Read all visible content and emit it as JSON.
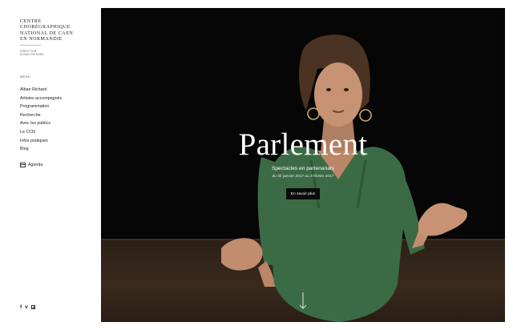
{
  "sidebar": {
    "logo_lines": [
      "CENTRE",
      "CHORÉGRAPHIQUE",
      "NATIONAL DE CAEN",
      "EN NORMANDIE"
    ],
    "direction_lines": [
      "DIRECTION",
      "ALBAN RICHARD"
    ],
    "menu_label": "MENU",
    "nav_items": [
      "Alban Richard",
      "Artistes accompagnés",
      "Programmation",
      "Recherche",
      "Avec les publics",
      "Le CCN",
      "Infos pratiques",
      "Blog"
    ],
    "agenda_label": "Agenda",
    "social": {
      "facebook": "f",
      "vimeo": "v"
    }
  },
  "hero": {
    "title": "Parlement",
    "subtitle": "Spectacles en partenariats",
    "dates": "du 30 janvier 2017 au 3 février 2017",
    "button_label": "En savoir plus"
  },
  "colors": {
    "hero_bg": "#060606",
    "shirt": "#3b6b45",
    "button_bg": "#0b0b0b"
  },
  "icons": [
    "agenda-icon",
    "facebook-icon",
    "vimeo-icon",
    "instagram-icon",
    "scroll-down-arrow-icon"
  ]
}
